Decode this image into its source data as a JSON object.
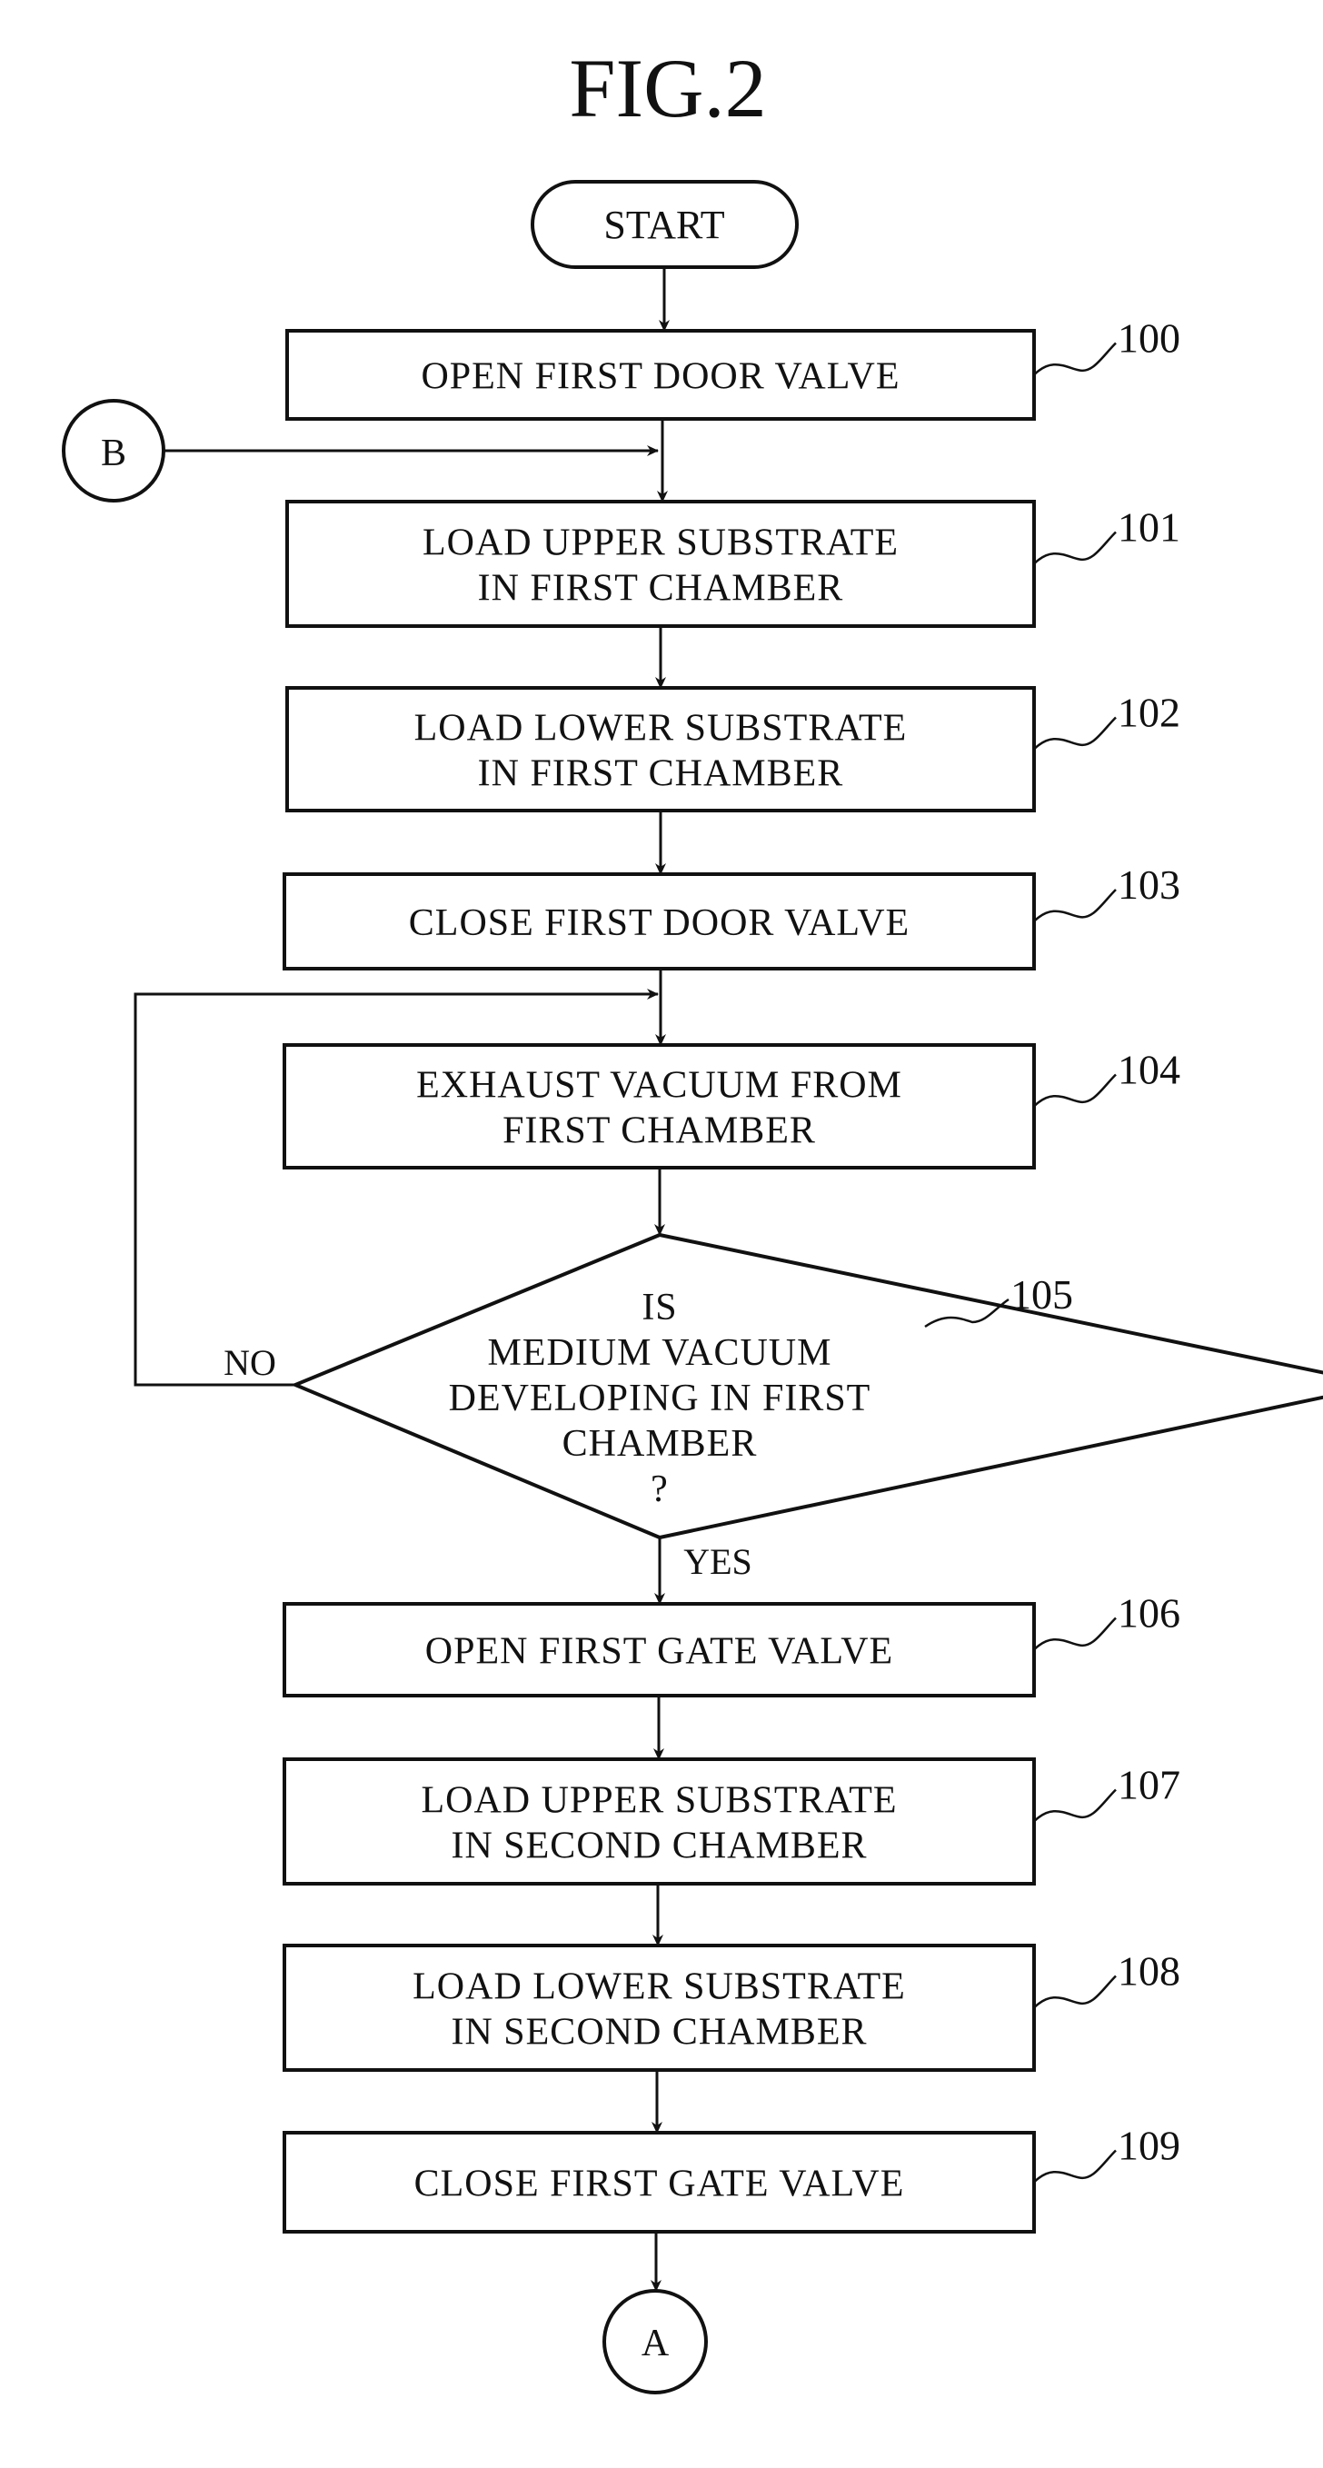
{
  "figure": {
    "title": "FIG.2",
    "start_label": "START",
    "connector_in": "B",
    "connector_out": "A",
    "steps": [
      {
        "ref": "100",
        "lines": [
          "OPEN FIRST DOOR VALVE"
        ]
      },
      {
        "ref": "101",
        "lines": [
          "LOAD UPPER SUBSTRATE",
          "IN FIRST CHAMBER"
        ]
      },
      {
        "ref": "102",
        "lines": [
          "LOAD LOWER SUBSTRATE",
          "IN FIRST CHAMBER"
        ]
      },
      {
        "ref": "103",
        "lines": [
          "CLOSE FIRST DOOR VALVE"
        ]
      },
      {
        "ref": "104",
        "lines": [
          "EXHAUST VACUUM FROM",
          "FIRST CHAMBER"
        ]
      },
      {
        "ref": "106",
        "lines": [
          "OPEN FIRST GATE VALVE"
        ]
      },
      {
        "ref": "107",
        "lines": [
          "LOAD UPPER SUBSTRATE",
          "IN SECOND CHAMBER"
        ]
      },
      {
        "ref": "108",
        "lines": [
          "LOAD LOWER SUBSTRATE",
          "IN SECOND CHAMBER"
        ]
      },
      {
        "ref": "109",
        "lines": [
          "CLOSE FIRST GATE VALVE"
        ]
      }
    ],
    "decision": {
      "ref": "105",
      "lines": [
        "IS",
        "MEDIUM VACUUM",
        "DEVELOPING IN FIRST",
        "CHAMBER",
        "?"
      ],
      "no_label": "NO",
      "yes_label": "YES"
    }
  }
}
